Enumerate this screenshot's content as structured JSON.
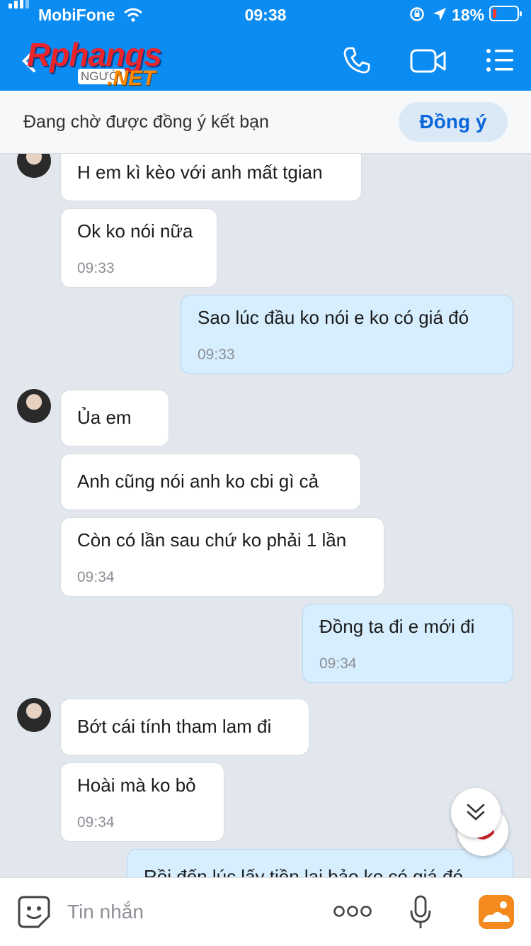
{
  "status_bar": {
    "carrier": "MobiFone",
    "time": "09:38",
    "battery": "18%"
  },
  "header": {
    "logo_main": "Rphangs",
    "logo_sub": "NGƯỜI",
    "logo_net": ".NET"
  },
  "pending": {
    "text": "Đang chờ được đồng ý kết bạn",
    "accept_label": "Đồng ý"
  },
  "messages": [
    {
      "text": "H em kì kèo với anh mất tgian",
      "time": ""
    },
    {
      "text": "Ok ko nói nữa",
      "time": "09:33"
    },
    {
      "text": "Sao lúc đầu ko nói e ko có giá đó",
      "time": "09:33"
    },
    {
      "text": "Ủa em",
      "time": ""
    },
    {
      "text": "Anh cũng nói anh ko cbi gì cả",
      "time": ""
    },
    {
      "text": "Còn có lần sau chứ ko phải 1 lần",
      "time": "09:34"
    },
    {
      "text": "Đồng ta đi  e mới đi",
      "time": "09:34"
    },
    {
      "text": "Bớt cái tính tham lam đi",
      "time": ""
    },
    {
      "text": "Hoài mà ko bỏ",
      "time": "09:34"
    },
    {
      "text": "Rồi đến lúc lấy tiền lại bảo ko có giá đó",
      "time": ""
    }
  ],
  "input": {
    "placeholder": "Tin nhắn"
  },
  "colors": {
    "header_blue": "#0b8cf3",
    "my_bubble": "#d7eefe",
    "accept_text": "#0a66d8"
  }
}
